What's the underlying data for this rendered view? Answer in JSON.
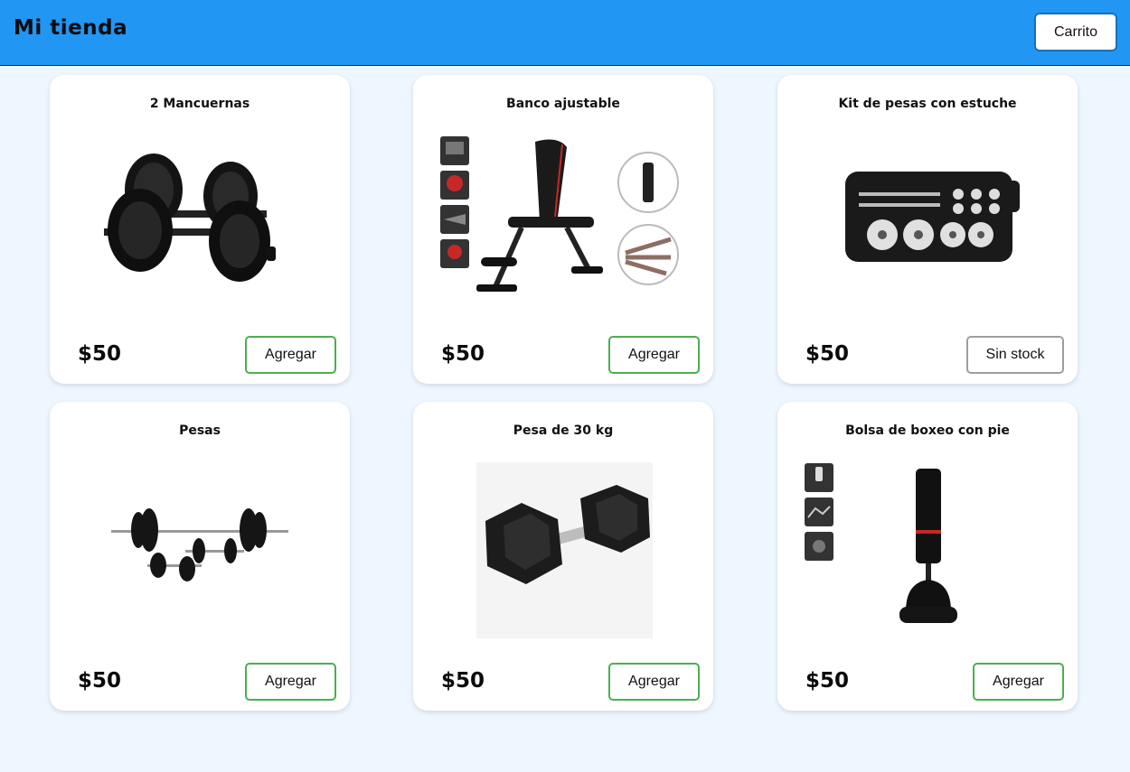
{
  "header": {
    "brand": "Mi tienda",
    "cart_label": "Carrito",
    "bg_color": "#2196f3"
  },
  "products": [
    {
      "title": "2 Mancuernas",
      "price": "$50",
      "button_label": "Agregar",
      "in_stock": true,
      "image_icon": "dumbbells-pair-icon"
    },
    {
      "title": "Banco ajustable",
      "price": "$50",
      "button_label": "Agregar",
      "in_stock": true,
      "image_icon": "adjustable-bench-icon"
    },
    {
      "title": "Kit de pesas con estuche",
      "price": "$50",
      "button_label": "Sin stock",
      "in_stock": false,
      "image_icon": "weight-kit-case-icon"
    },
    {
      "title": "Pesas",
      "price": "$50",
      "button_label": "Agregar",
      "in_stock": true,
      "image_icon": "barbell-set-icon"
    },
    {
      "title": "Pesa de 30 kg",
      "price": "$50",
      "button_label": "Agregar",
      "in_stock": true,
      "image_icon": "hex-dumbbell-icon"
    },
    {
      "title": "Bolsa de boxeo con pie",
      "price": "$50",
      "button_label": "Agregar",
      "in_stock": true,
      "image_icon": "punching-bag-icon"
    }
  ],
  "colors": {
    "page_bg": "#eef6ff",
    "add_border": "#4caf50",
    "out_of_stock_border": "#9e9e9e"
  }
}
